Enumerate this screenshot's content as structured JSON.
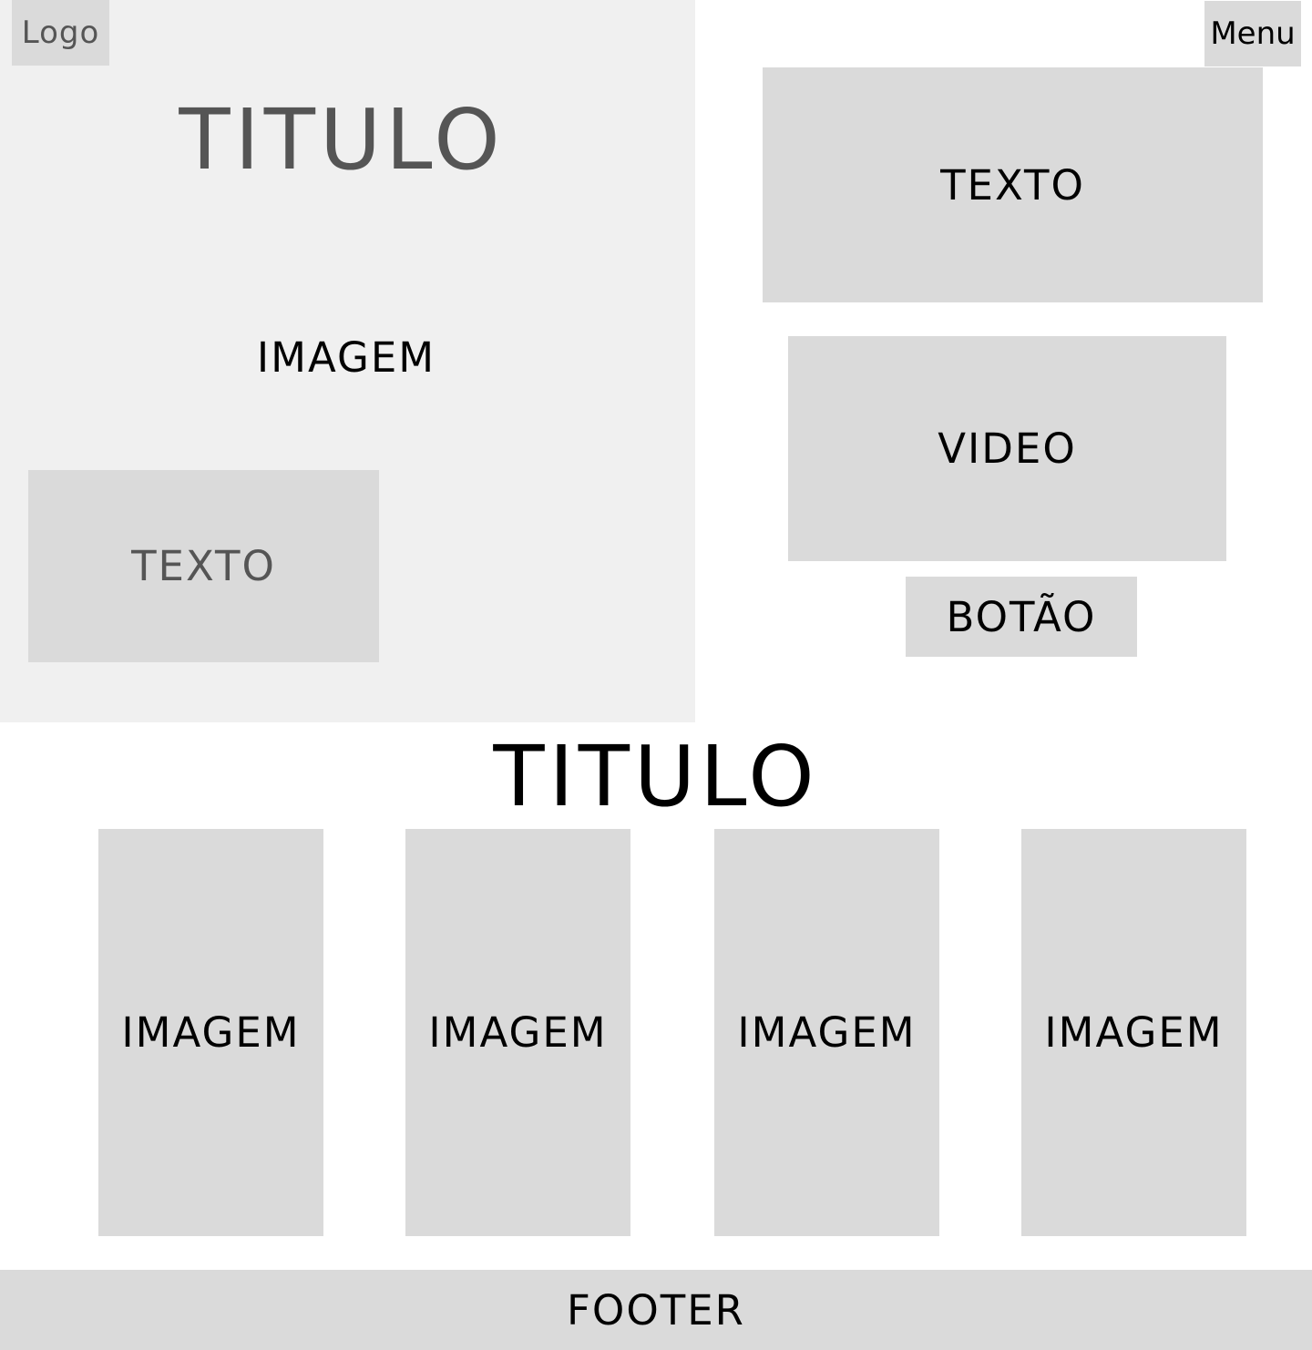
{
  "hero": {
    "logo": "Logo",
    "title": "TITULO",
    "image_label": "IMAGEM",
    "text_label": "TEXTO"
  },
  "header": {
    "menu": "Menu"
  },
  "aside": {
    "text_label": "TEXTO",
    "video_label": "VIDEO",
    "button_label": "BOTÃO"
  },
  "gallery": {
    "title": "TITULO",
    "cards": [
      {
        "label": "IMAGEM"
      },
      {
        "label": "IMAGEM"
      },
      {
        "label": "IMAGEM"
      },
      {
        "label": "IMAGEM"
      }
    ]
  },
  "footer": {
    "label": "FOOTER"
  },
  "colors": {
    "hero_background": "#f0f0f0",
    "block_background": "#dadada",
    "muted_text": "#555555",
    "text": "#000000",
    "page_background": "#ffffff"
  }
}
